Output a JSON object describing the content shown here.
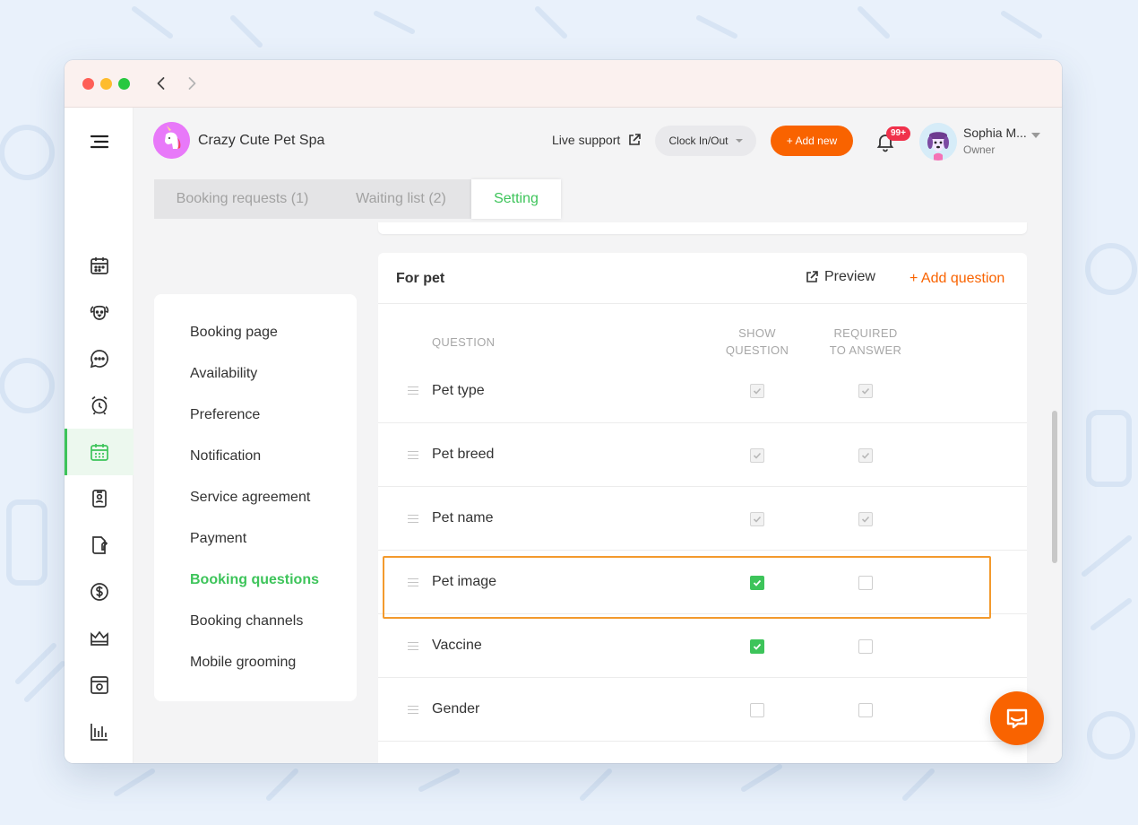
{
  "business": {
    "name": "Crazy Cute Pet Spa"
  },
  "header": {
    "live_support": "Live support",
    "clock_in_out": "Clock In/Out",
    "add_new": "+ Add new",
    "notification_badge": "99+",
    "user_name": "Sophia M...",
    "user_role": "Owner"
  },
  "rail": {
    "items": [
      "menu",
      "calendar",
      "pets",
      "messages",
      "reminders",
      "online-booking",
      "clients",
      "reports-doc",
      "payments",
      "membership",
      "retail",
      "insights",
      "settings"
    ],
    "active": "online-booking"
  },
  "tabs": [
    {
      "label": "Booking requests (1)"
    },
    {
      "label": "Waiting list (2)"
    },
    {
      "label": "Setting"
    }
  ],
  "settings_nav": {
    "items": [
      {
        "label": "Booking page"
      },
      {
        "label": "Availability"
      },
      {
        "label": "Preference"
      },
      {
        "label": "Notification"
      },
      {
        "label": "Service agreement"
      },
      {
        "label": "Payment"
      },
      {
        "label": "Booking questions"
      },
      {
        "label": "Booking channels"
      },
      {
        "label": "Mobile grooming"
      }
    ],
    "active_index": 6
  },
  "pet_questions": {
    "title": "For pet",
    "preview": "Preview",
    "add_question": "+ Add question",
    "columns": {
      "question": "QUESTION",
      "show_line1": "SHOW",
      "show_line2": "QUESTION",
      "required_line1": "REQUIRED",
      "required_line2": "TO ANSWER"
    },
    "rows": [
      {
        "label": "Pet type",
        "show": "checked-disabled",
        "required": "checked-disabled"
      },
      {
        "label": "Pet breed",
        "show": "checked-disabled",
        "required": "checked-disabled"
      },
      {
        "label": "Pet name",
        "show": "checked-disabled",
        "required": "checked-disabled"
      },
      {
        "label": "Pet image",
        "show": "checked",
        "required": "unchecked"
      },
      {
        "label": "Vaccine",
        "show": "checked",
        "required": "unchecked"
      },
      {
        "label": "Gender",
        "show": "unchecked",
        "required": "unchecked"
      }
    ],
    "highlighted_row": "Pet image"
  },
  "colors": {
    "accent_green": "#3dc45a",
    "accent_orange": "#f96300",
    "badge_red": "#f0314b",
    "highlight_orange": "#f39a2d"
  }
}
